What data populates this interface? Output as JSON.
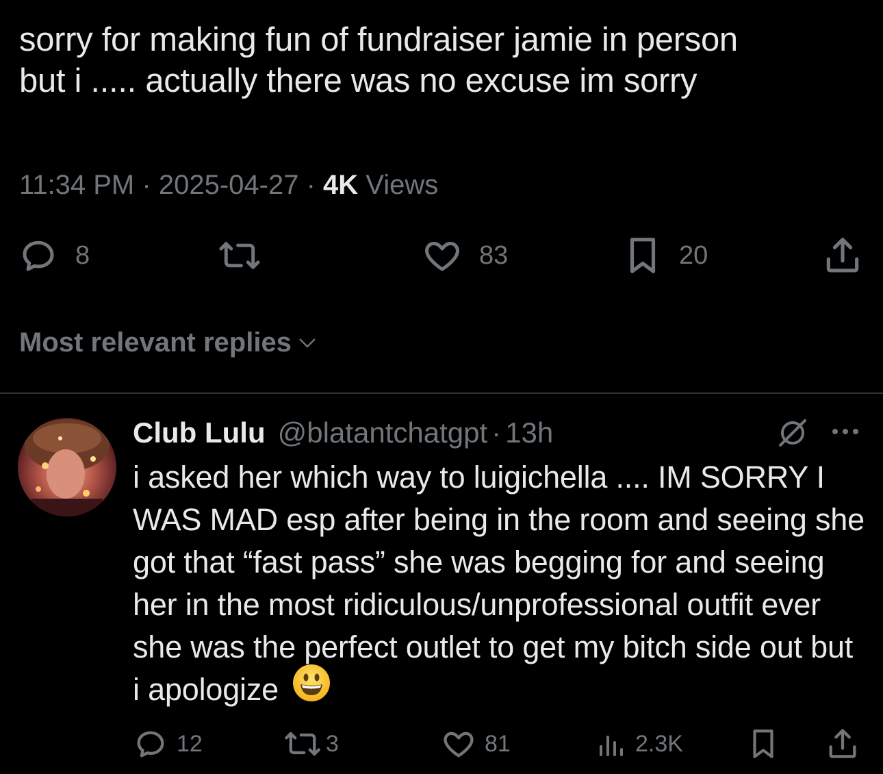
{
  "tweet": {
    "text_line1": "sorry for making fun of fundraiser jamie in person",
    "text_line2": "but i ..... actually there was no excuse im sorry",
    "time": "11:34 PM",
    "date": "2025-04-27",
    "views_count": "4K",
    "views_label": "Views",
    "dot": "·"
  },
  "tweet_actions": {
    "replies": "8",
    "retweets": "",
    "likes": "83",
    "bookmarks": "20"
  },
  "replies_sort": {
    "label": "Most relevant replies"
  },
  "reply": {
    "name": "Club Lulu",
    "handle": "@blatantchatgpt",
    "dot": "·",
    "time": "13h",
    "text": "i asked her which way to luigichella .... IM SORRY I WAS MAD esp after being in the room and seeing she got that “fast pass” she was begging for and seeing her in the most ridiculous/unprofessional outfit ever she was the perfect outlet to get my bitch side out but i apologize",
    "emoji": "grinning-face-emoji",
    "actions": {
      "replies": "12",
      "retweets": "3",
      "likes": "81",
      "views": "2.3K"
    }
  },
  "colors": {
    "background": "#000000",
    "primary_text": "#e7e9ea",
    "secondary_text": "#71767b",
    "divider": "#2f3336"
  },
  "icons": {
    "reply": "reply-icon",
    "retweet": "retweet-icon",
    "like": "heart-icon",
    "bookmark": "bookmark-icon",
    "share": "share-icon",
    "views": "analytics-icon",
    "grok": "grok-icon",
    "more": "more-icon",
    "chevron": "chevron-down-icon"
  }
}
